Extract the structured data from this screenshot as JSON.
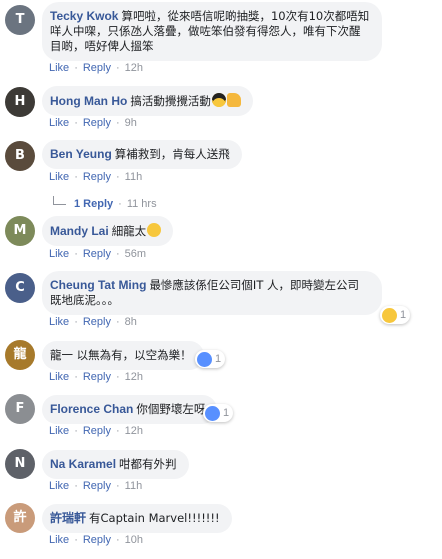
{
  "comments": [
    {
      "name": "Tecky Kwok",
      "text": "算吧啦，從來唔信呢啲抽獎，10次有10次都唔知咩人中㗎，只係氹人落疊，做咗笨伯發有得怨人，唯有下次醒目啲，唔好俾人搵笨",
      "like": "Like",
      "reply": "Reply",
      "time": "12h",
      "avatar_color": "#6b7480"
    },
    {
      "name": "Hong Man Ho",
      "text": "搞活動攪攪活動",
      "like": "Like",
      "reply": "Reply",
      "time": "9h",
      "emojis": [
        "sunglasses-face",
        "thumbs-up"
      ],
      "avatar_color": "#3d3a36"
    },
    {
      "name": "Ben Yeung",
      "text": "算補救到，肯每人送飛",
      "like": "Like",
      "reply": "Reply",
      "time": "11h",
      "avatar_color": "#5a4b3c",
      "replies": {
        "label": "1 Reply",
        "time": "11 hrs"
      }
    },
    {
      "name": "Mandy Lai",
      "text": "細龍太",
      "like": "Like",
      "reply": "Reply",
      "time": "56m",
      "emojis": [
        "laughing-face"
      ],
      "avatar_color": "#7d8a5a"
    },
    {
      "name": "Cheung Tat Ming",
      "text": "最慘應該係佢公司個IT 人，即時變左公司既地底泥。。。",
      "like": "Like",
      "reply": "Reply",
      "time": "8h",
      "avatar_color": "#4a5f8a",
      "reaction": {
        "type": "haha",
        "count": "1"
      }
    },
    {
      "name": "",
      "text": "龍一 以無為有，以空為樂！",
      "like": "Like",
      "reply": "Reply",
      "time": "12h",
      "avatar_color": "#a77a2b",
      "reaction": {
        "type": "like",
        "count": "1"
      }
    },
    {
      "name": "Florence Chan",
      "text": "你個野壞左呀",
      "like": "Like",
      "reply": "Reply",
      "time": "12h",
      "avatar_color": "#8b8e92",
      "reaction": {
        "type": "like",
        "count": "1"
      }
    },
    {
      "name": "Na Karamel",
      "text": "咁都有外判",
      "like": "Like",
      "reply": "Reply",
      "time": "11h",
      "avatar_color": "#5e6168"
    },
    {
      "name": "許瑞軒",
      "text": "有Captain Marvel!!!!!!!",
      "like": "Like",
      "reply": "Reply",
      "time": "10h",
      "avatar_color": "#c99b7a"
    }
  ]
}
